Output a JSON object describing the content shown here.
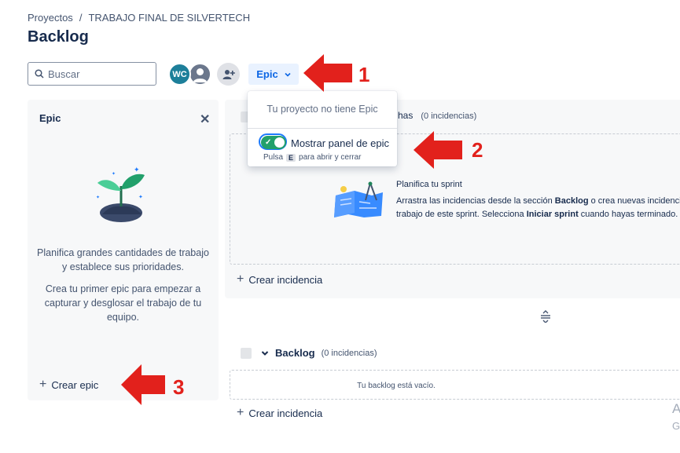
{
  "breadcrumb": {
    "project_label": "Proyectos",
    "separator": "/",
    "project_name": "TRABAJO FINAL DE SILVERTECH"
  },
  "page_title": "Backlog",
  "search": {
    "placeholder": "Buscar",
    "value": ""
  },
  "avatars": {
    "initials": "WC"
  },
  "epic_filter": {
    "label": "Epic"
  },
  "epic_dropdown": {
    "empty_text": "Tu proyecto no tiene Epic",
    "toggle_label": "Mostrar panel de epic",
    "toggle_on": true,
    "hint_prefix": "Pulsa",
    "hint_key": "E",
    "hint_suffix": "para abrir y cerrar"
  },
  "epic_panel": {
    "title": "Epic",
    "close": "✕",
    "description_1": "Planifica grandes cantidades de trabajo y establece sus prioridades.",
    "description_2": "Crea tu primer epic para empezar a capturar y desglosar el trabajo de tu equipo.",
    "create_label": "Crear epic"
  },
  "sprint": {
    "name_fragment": "has",
    "count": "(0 incidencias)",
    "plan_title": "Planifica tu sprint",
    "desc_line1_a": "Arrastra las incidencias desde la sección ",
    "desc_line1_b": "Backlog",
    "desc_line1_c": " o crea nuevas incidencias",
    "desc_line2_a": "trabajo de este sprint. Selecciona ",
    "desc_line2_b": "Iniciar sprint",
    "desc_line2_c": " cuando hayas terminado.",
    "create_label": "Crear incidencia"
  },
  "backlog": {
    "title": "Backlog",
    "count": "(0 incidencias)",
    "empty_text": "Tu backlog está vacío.",
    "create_label": "Crear incidencia"
  },
  "edge_fragment": {
    "line1": "A",
    "line2": "G"
  },
  "annotations": {
    "one": "1",
    "two": "2",
    "three": "3"
  },
  "colors": {
    "accent": "#0c66e4",
    "toggle_on": "#22a06b",
    "annotation_red": "#e2211c",
    "panel_bg": "#f7f8f9"
  }
}
